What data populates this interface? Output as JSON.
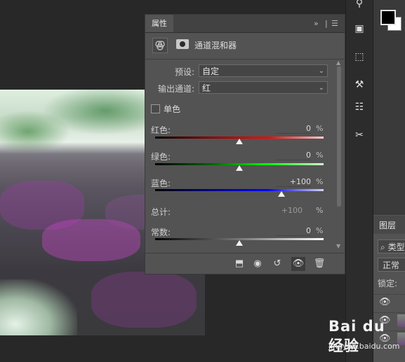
{
  "panel": {
    "tab_label": "属性",
    "expand_icon": "double-chevron-right-icon",
    "menu_icon": "hamburger-menu-icon",
    "title": "通道混和器",
    "preset_label": "预设:",
    "preset_value": "自定",
    "output_label": "输出通道:",
    "output_value": "红",
    "mono_label": "单色",
    "mono_checked": false,
    "sliders": [
      {
        "label": "红色:",
        "value": "0",
        "unit": "%",
        "level": 0,
        "gradient": "linear-gradient(90deg,#000,#8b0000,#ff0000,#ffd0d0)"
      },
      {
        "label": "绿色:",
        "value": "0",
        "unit": "%",
        "level": 0,
        "gradient": "linear-gradient(90deg,#000,#006400,#00ff00,#d0ffd0)"
      },
      {
        "label": "蓝色:",
        "value": "+100",
        "unit": "%",
        "level": 100,
        "gradient": "linear-gradient(90deg,#000,#00008b,#0000ff,#d0d0ff)"
      }
    ],
    "total_label": "总计:",
    "total_value": "+100",
    "total_unit": "%",
    "constant": {
      "label": "常数:",
      "value": "0",
      "unit": "%",
      "level": 0,
      "gradient": "linear-gradient(90deg,#000,#777,#fff)"
    },
    "footer_icons": [
      "clip-to-layer-icon",
      "view-previous-state-icon",
      "reset-icon",
      "visibility-eye-icon",
      "trash-icon"
    ]
  },
  "layers": {
    "tab_label": "图层",
    "search_text": "类型",
    "blend_mode": "正常",
    "lock_label": "锁定:"
  },
  "watermark": {
    "logo": "Bai du 经验",
    "url": "jingyan.baidu.com"
  }
}
